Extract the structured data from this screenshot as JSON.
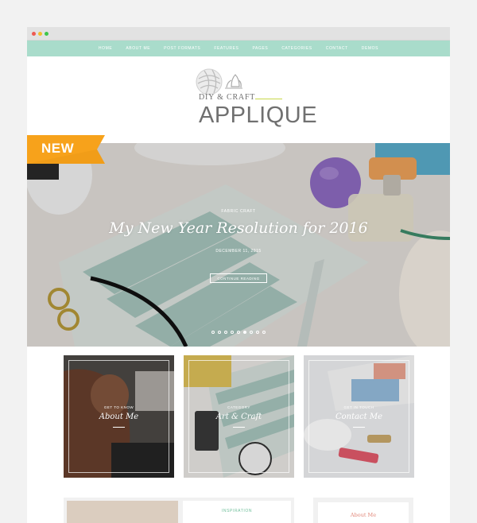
{
  "nav": {
    "items": [
      "HOME",
      "ABOUT ME",
      "POST FORMATS",
      "FEATURES",
      "PAGES",
      "CATEGORIES",
      "CONTACT",
      "DEMOS"
    ]
  },
  "logo": {
    "tagline": "DIY & CRAFT",
    "title": "APPLIQUE",
    "icon": "yarn-ball-lotus-icon"
  },
  "ribbon": {
    "label": "NEW",
    "color": "#f7a21b"
  },
  "hero": {
    "category": "FABRIC CRAFT",
    "title": "My New Year Resolution for 2016",
    "date": "DECEMBER 11, 2015",
    "button": "CONTINUE READING",
    "slides": 9,
    "active_slide": 5
  },
  "cards": [
    {
      "subtitle": "GET TO KNOW",
      "title": "About Me"
    },
    {
      "subtitle": "CATEGORY",
      "title": "Art & Craft"
    },
    {
      "subtitle": "GET IN TOUCH",
      "title": "Contact Me"
    }
  ],
  "bottom": {
    "left_label": "INSPIRATION",
    "right_label": "About Me"
  },
  "colors": {
    "nav_bg": "#a9dccb",
    "accent_green": "#6fbf9b",
    "accent_coral": "#e2887a",
    "ribbon": "#f7a21b"
  }
}
